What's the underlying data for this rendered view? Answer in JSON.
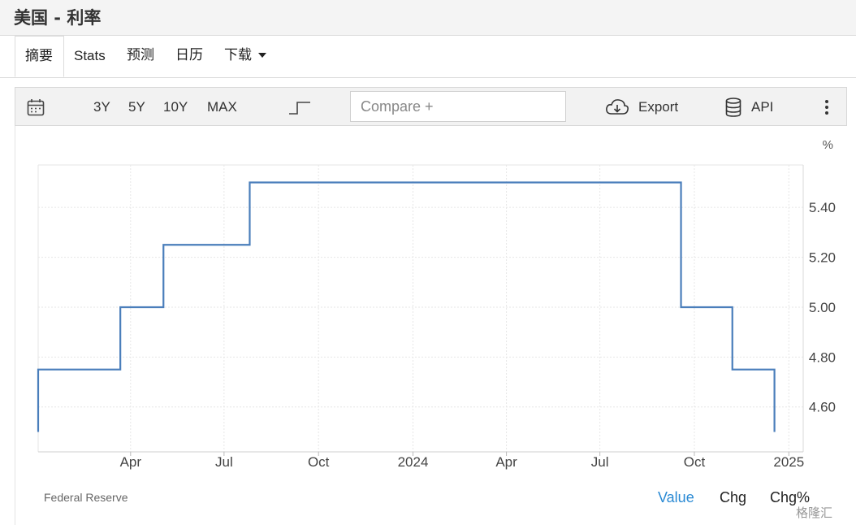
{
  "page": {
    "title": "美国 - 利率"
  },
  "tabs": [
    {
      "label": "摘要",
      "active": true
    },
    {
      "label": "Stats"
    },
    {
      "label": "预测"
    },
    {
      "label": "日历"
    },
    {
      "label": "下载",
      "dropdown": true
    }
  ],
  "toolbar": {
    "ranges": [
      "3Y",
      "5Y",
      "10Y",
      "MAX"
    ],
    "compare_placeholder": "Compare +",
    "export_label": "Export",
    "api_label": "API",
    "icons": [
      "calendar-icon",
      "step-line-icon",
      "cloud-download-icon",
      "database-icon",
      "more-vertical-icon"
    ]
  },
  "chart_data": {
    "type": "line",
    "line_style": "step",
    "unit_label": "%",
    "color": "#4a7ebb",
    "x_tick_labels": [
      "Apr",
      "Jul",
      "Oct",
      "2024",
      "Apr",
      "Jul",
      "Oct",
      "2025"
    ],
    "y_tick_labels": [
      "5.40",
      "5.20",
      "5.00",
      "4.80",
      "4.60"
    ],
    "ylim": [
      4.42,
      5.57
    ],
    "grid": true,
    "series": [
      {
        "points": [
          {
            "x": "2023-01-01",
            "y": 4.5
          },
          {
            "x": "2023-01-01",
            "y": 4.75
          },
          {
            "x": "2023-03-22",
            "y": 5.0
          },
          {
            "x": "2023-05-03",
            "y": 5.25
          },
          {
            "x": "2023-07-26",
            "y": 5.5
          },
          {
            "x": "2024-09-18",
            "y": 5.0
          },
          {
            "x": "2024-11-07",
            "y": 4.75
          },
          {
            "x": "2024-12-18",
            "y": 4.5
          }
        ]
      }
    ]
  },
  "footer": {
    "source": "Federal Reserve",
    "tabs": [
      {
        "label": "Value",
        "active": true,
        "color": "#2a8ad4"
      },
      {
        "label": "Chg"
      },
      {
        "label": "Chg%"
      }
    ]
  },
  "watermark": "格隆汇"
}
